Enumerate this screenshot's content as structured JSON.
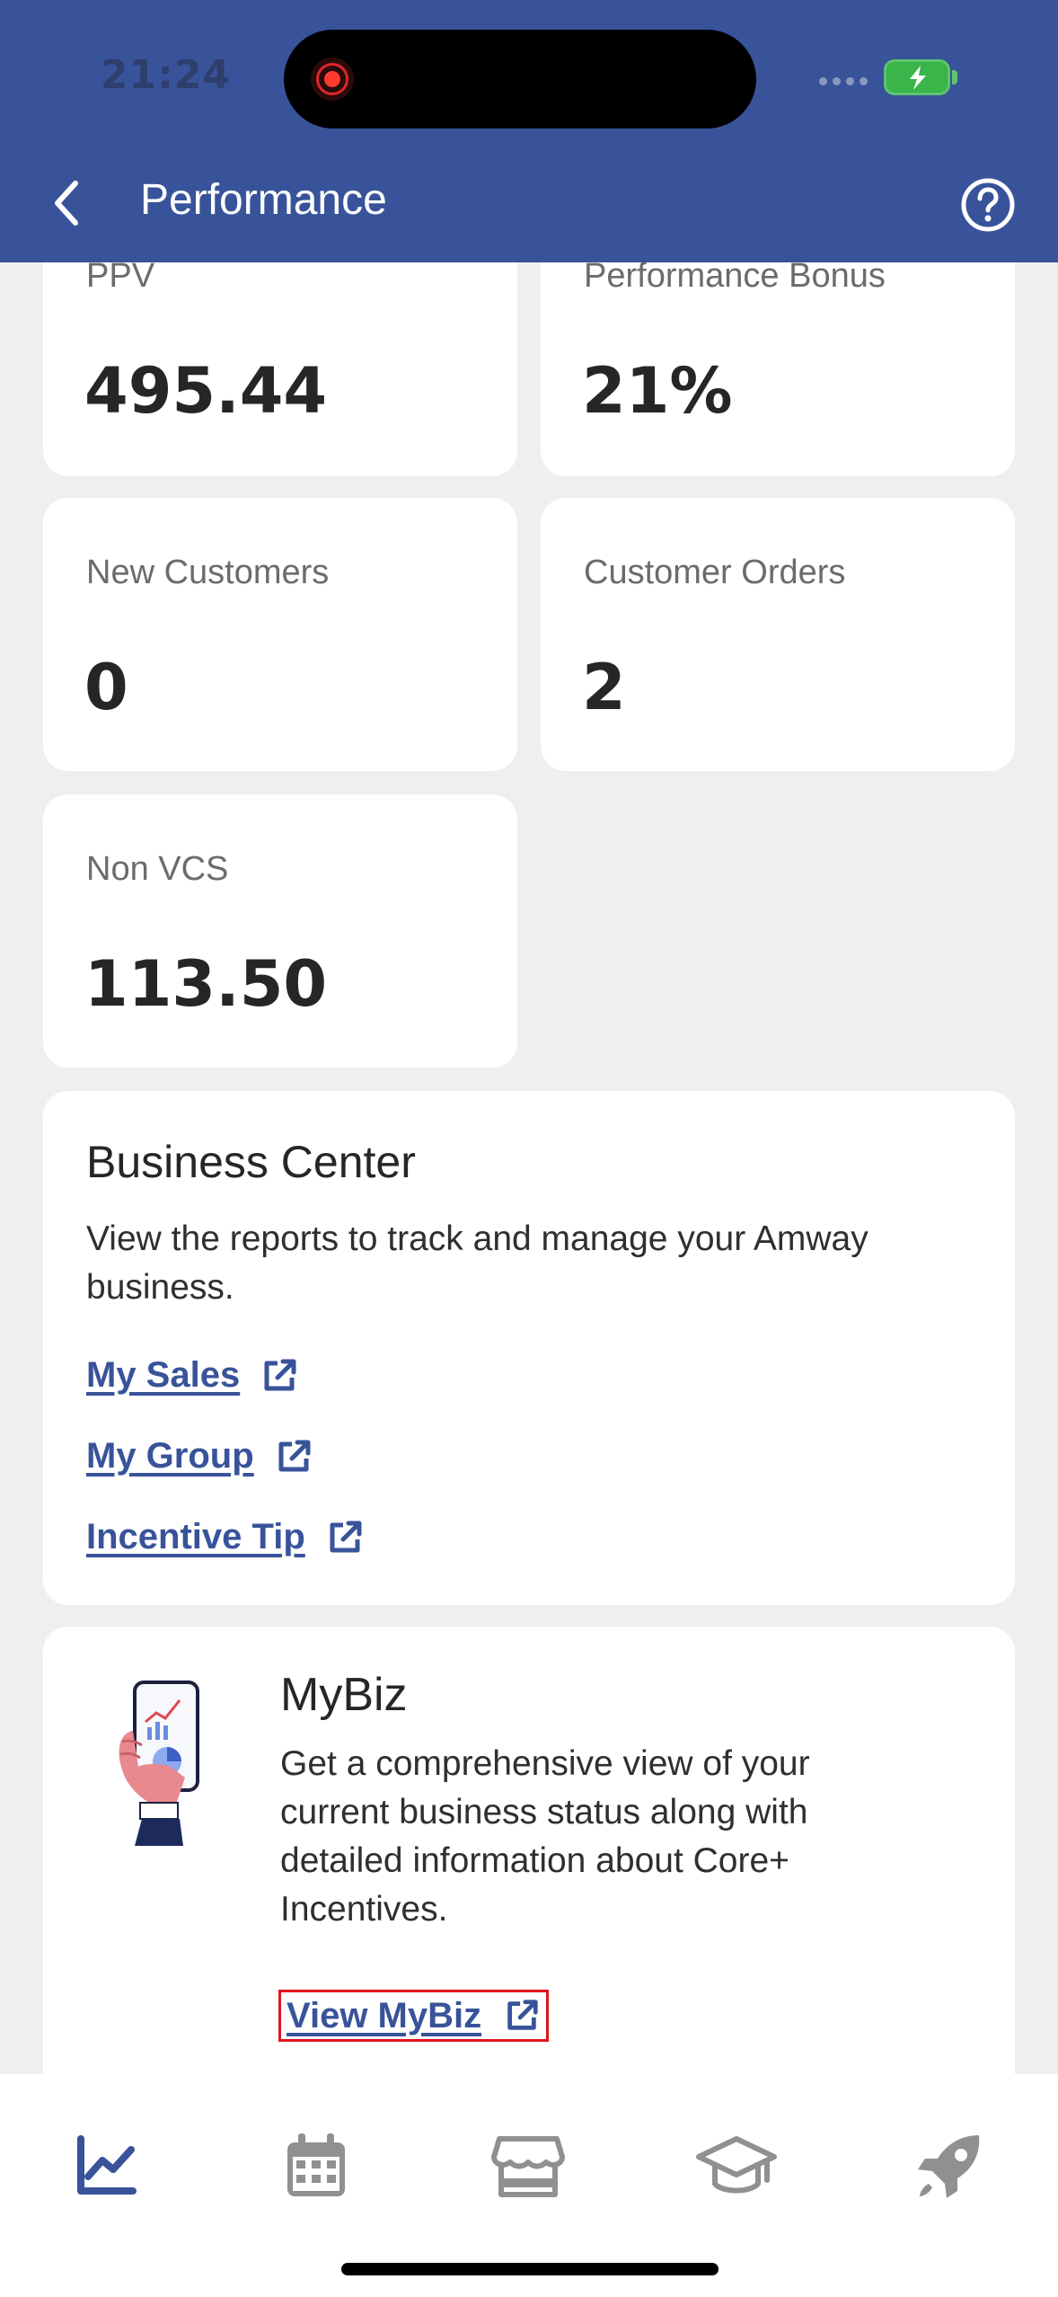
{
  "status_bar": {
    "time": "21:24"
  },
  "header": {
    "title": "Performance"
  },
  "metrics": [
    {
      "label": "PPV",
      "value": "495.44"
    },
    {
      "label": "Performance Bonus",
      "value": "21%"
    },
    {
      "label": "New Customers",
      "value": "0"
    },
    {
      "label": "Customer Orders",
      "value": "2"
    },
    {
      "label": "Non VCS",
      "value": "113.50"
    }
  ],
  "business_center": {
    "title": "Business Center",
    "description": "View the reports to track and manage your Amway business.",
    "links": [
      "My Sales",
      "My Group",
      "Incentive Tip"
    ]
  },
  "mybiz": {
    "title": "MyBiz",
    "description": "Get a comprehensive view of your current business status along with detailed information about Core+ Incentives.",
    "link": "View MyBiz"
  },
  "bottom_nav": {
    "items": [
      {
        "icon": "performance-chart-icon",
        "active": true
      },
      {
        "icon": "calendar-icon",
        "active": false
      },
      {
        "icon": "store-icon",
        "active": false
      },
      {
        "icon": "graduation-cap-icon",
        "active": false
      },
      {
        "icon": "rocket-icon",
        "active": false
      }
    ]
  },
  "colors": {
    "brand": "#38539a",
    "background": "#efefef",
    "highlight": "#e0141c"
  }
}
